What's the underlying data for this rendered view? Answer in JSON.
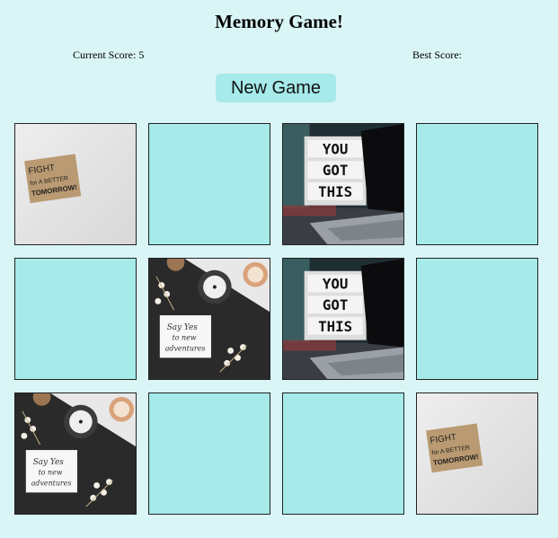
{
  "title": "Memory Game!",
  "scores": {
    "current_label": "Current Score: 5",
    "best_label": "Best Score:"
  },
  "new_game_label": "New Game",
  "colors": {
    "background": "#d9f5f5",
    "card_back": "#a6eaea",
    "button": "#a6eaea"
  },
  "cards": [
    {
      "state": "revealed",
      "image": "fight-note",
      "note": [
        "FIGHT",
        "for A BETTER",
        "TOMORROW!"
      ]
    },
    {
      "state": "hidden"
    },
    {
      "state": "revealed",
      "image": "you-got-this",
      "note": [
        "YOU",
        "GOT",
        "THIS"
      ]
    },
    {
      "state": "hidden"
    },
    {
      "state": "hidden"
    },
    {
      "state": "revealed",
      "image": "say-yes-candles",
      "note": [
        "Say Yes",
        "to new",
        "adventures"
      ]
    },
    {
      "state": "revealed",
      "image": "you-got-this",
      "note": [
        "YOU",
        "GOT",
        "THIS"
      ]
    },
    {
      "state": "hidden"
    },
    {
      "state": "revealed",
      "image": "say-yes-candles",
      "note": [
        "Say Yes",
        "to new",
        "adventures"
      ]
    },
    {
      "state": "hidden"
    },
    {
      "state": "hidden"
    },
    {
      "state": "revealed",
      "image": "fight-note",
      "note": [
        "FIGHT",
        "for A BETTER",
        "TOMORROW!"
      ]
    }
  ]
}
